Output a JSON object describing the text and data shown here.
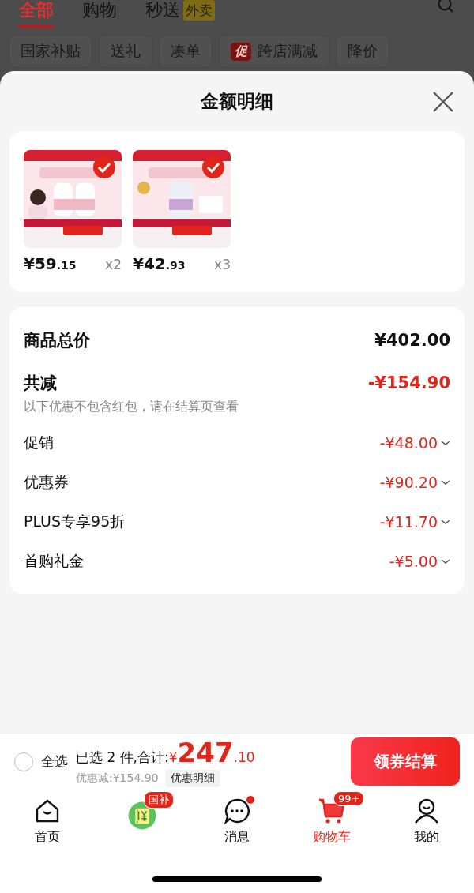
{
  "top_tabs": [
    {
      "label": "全部",
      "selected": true
    },
    {
      "label": "购物",
      "selected": false
    },
    {
      "label": "秒送",
      "selected": false,
      "badge": "外卖"
    }
  ],
  "chips": [
    {
      "label": "国家补贴"
    },
    {
      "label": "送礼"
    },
    {
      "label": "凑单"
    },
    {
      "label": "跨店满减",
      "tag": "促"
    },
    {
      "label": "降价"
    }
  ],
  "sheet": {
    "title": "金额明细",
    "products": [
      {
        "kind": "picture",
        "selected": true,
        "yuan": "¥59",
        "cents": ".15",
        "qty": "x2"
      },
      {
        "kind": "picture",
        "selected": true,
        "yuan": "¥42",
        "cents": ".93",
        "qty": "x3"
      }
    ],
    "rows": [
      {
        "kind": "total",
        "label": "商品总价",
        "value": "¥402.00"
      },
      {
        "kind": "reduction",
        "label": "共减",
        "value": "-¥154.90",
        "note": "以下优惠不包含红包，请在结算页查看"
      },
      {
        "kind": "detail",
        "label": "促销",
        "value": "-¥48.00"
      },
      {
        "kind": "detail",
        "label": "优惠券",
        "value": "-¥90.20"
      },
      {
        "kind": "detail",
        "label": "PLUS专享95折",
        "value": "-¥11.70"
      },
      {
        "kind": "detail",
        "label": "首购礼金",
        "value": "-¥5.00"
      }
    ]
  },
  "checkout": {
    "select_all": {
      "label": "全选",
      "checked": false
    },
    "summary": "已选 2 件,合计:",
    "currency": "¥",
    "amount": "247",
    "cents": ".10",
    "saved": "优惠减:¥154.90",
    "detail_button": "优惠明细",
    "button": "领券结算"
  },
  "tab_bar": [
    {
      "label": "首页",
      "selected": false
    },
    {
      "badge": "国补",
      "selected": false
    },
    {
      "label": "消息",
      "selected": false,
      "dot": true
    },
    {
      "label": "购物车",
      "selected": true,
      "badge": "99+"
    },
    {
      "label": "我的",
      "selected": false
    }
  ]
}
